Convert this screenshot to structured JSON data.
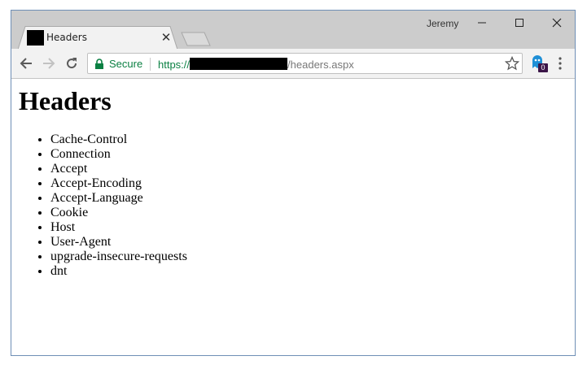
{
  "window": {
    "profile_name": "Jeremy"
  },
  "tab": {
    "title": "Headers",
    "close_label": "✕"
  },
  "omnibox": {
    "secure_label": "Secure",
    "url_scheme": "https://",
    "url_path": "/headers.aspx"
  },
  "extension": {
    "badge": "0"
  },
  "page": {
    "heading": "Headers",
    "headers": [
      "Cache-Control",
      "Connection",
      "Accept",
      "Accept-Encoding",
      "Accept-Language",
      "Cookie",
      "Host",
      "User-Agent",
      "upgrade-insecure-requests",
      "dnt"
    ]
  },
  "colors": {
    "secure_green": "#0b8043",
    "frame_gray": "#cccccc",
    "toolbar_gray": "#f2f2f2",
    "window_border": "#6f8fb6"
  },
  "icons": {
    "back": "arrow-left-icon",
    "forward": "arrow-right-icon",
    "reload": "reload-icon",
    "lock": "lock-icon",
    "bookmark": "star-icon",
    "extension": "ghost-extension-icon",
    "menu": "kebab-menu-icon"
  }
}
